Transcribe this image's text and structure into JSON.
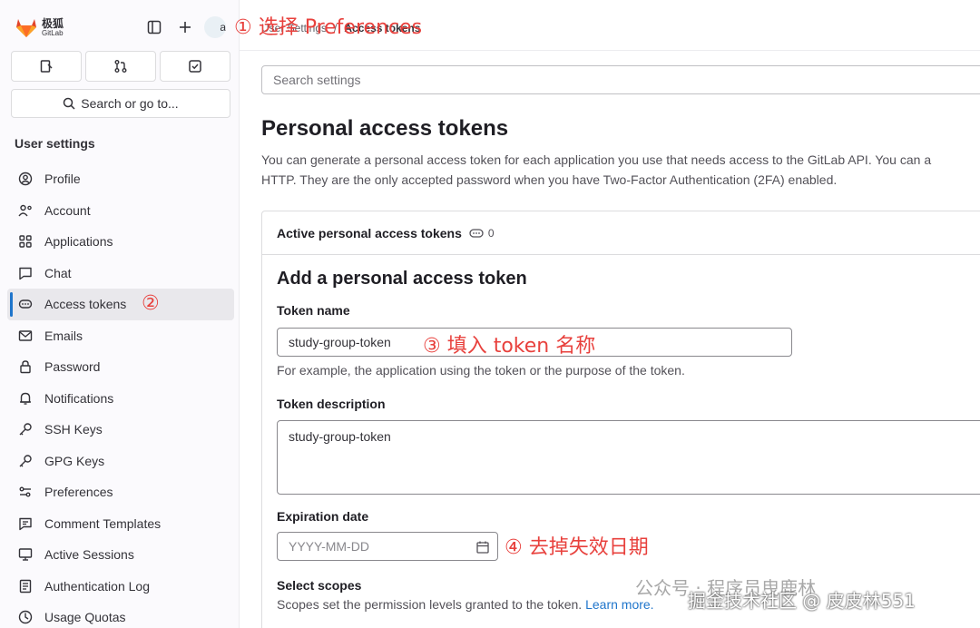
{
  "brand": {
    "name_cn": "极狐",
    "name_en": "GitLab",
    "accent": "#e24329"
  },
  "avatar": {
    "alt_text": "a"
  },
  "sidebar": {
    "search_label": "Search or go to...",
    "section_title": "User settings",
    "items": [
      {
        "label": "Profile",
        "icon": "user-circle-icon"
      },
      {
        "label": "Account",
        "icon": "user-gear-icon"
      },
      {
        "label": "Applications",
        "icon": "grid-icon"
      },
      {
        "label": "Chat",
        "icon": "chat-icon"
      },
      {
        "label": "Access tokens",
        "icon": "token-icon",
        "active": true
      },
      {
        "label": "Emails",
        "icon": "mail-icon"
      },
      {
        "label": "Password",
        "icon": "lock-icon"
      },
      {
        "label": "Notifications",
        "icon": "bell-icon"
      },
      {
        "label": "SSH Keys",
        "icon": "key-icon"
      },
      {
        "label": "GPG Keys",
        "icon": "key-icon"
      },
      {
        "label": "Preferences",
        "icon": "sliders-icon"
      },
      {
        "label": "Comment Templates",
        "icon": "comment-icon"
      },
      {
        "label": "Active Sessions",
        "icon": "monitor-icon"
      },
      {
        "label": "Authentication Log",
        "icon": "log-icon"
      },
      {
        "label": "Usage Quotas",
        "icon": "quota-icon"
      }
    ]
  },
  "breadcrumb": {
    "parent": "User Settings",
    "separator": "/",
    "current": "Access tokens"
  },
  "settings_search": {
    "placeholder": "Search settings"
  },
  "page": {
    "title": "Personal access tokens",
    "desc_line1": "You can generate a personal access token for each application you use that needs access to the GitLab API. You can a",
    "desc_line2": "HTTP. They are the only accepted password when you have Two-Factor Authentication (2FA) enabled."
  },
  "card": {
    "header": "Active personal access tokens",
    "count": "0",
    "form_title": "Add a personal access token",
    "token_name_label": "Token name",
    "token_name_value": "study-group-token",
    "token_name_help": "For example, the application using the token or the purpose of the token.",
    "token_desc_label": "Token description",
    "token_desc_value": "study-group-token",
    "expiration_label": "Expiration date",
    "expiration_placeholder": "YYYY-MM-DD",
    "scopes_label": "Select scopes",
    "scopes_help": "Scopes set the permission levels granted to the token.",
    "learn_more": "Learn more."
  },
  "annotations": {
    "a1": "① 选择 Preferences",
    "a2": "②",
    "a3": "③ 填入 token 名称",
    "a4": "④ 去掉失效日期"
  },
  "watermark": {
    "line1": "公众号 · 程序员曳鹿林",
    "line2": "掘金技术社区 @ 皮皮林551"
  }
}
